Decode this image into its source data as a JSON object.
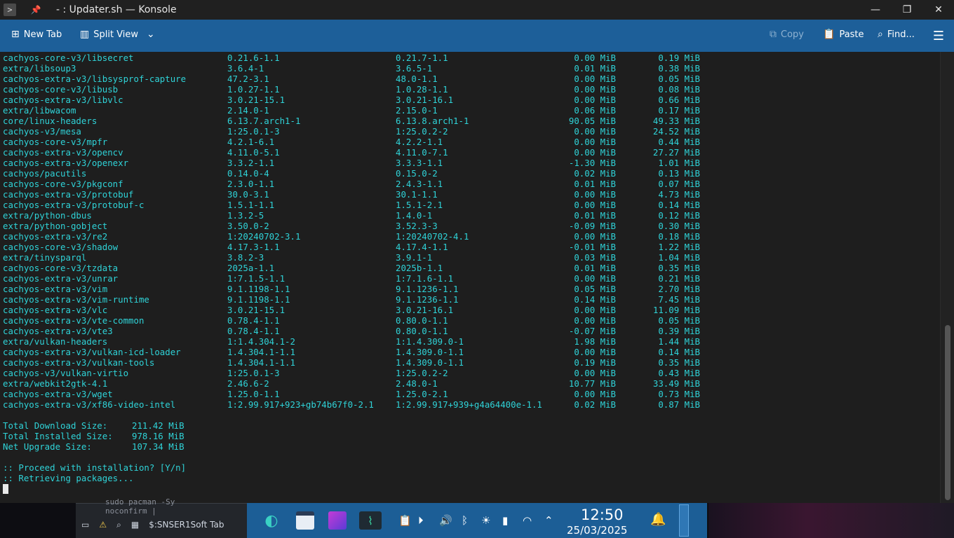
{
  "window": {
    "title": "- : Updater.sh — Konsole",
    "app_icon": "terminal-icon",
    "pin_icon": "pin-icon"
  },
  "toolbar": {
    "new_tab": "New Tab",
    "split_view": "Split View",
    "copy": "Copy",
    "paste": "Paste",
    "find": "Find..."
  },
  "packages": [
    [
      "cachyos-core-v3/libsecret",
      "0.21.6-1.1",
      "0.21.7-1.1",
      "0.00 MiB",
      "0.19 MiB"
    ],
    [
      "extra/libsoup3",
      "3.6.4-1",
      "3.6.5-1",
      "0.01 MiB",
      "0.38 MiB"
    ],
    [
      "cachyos-extra-v3/libsysprof-capture",
      "47.2-3.1",
      "48.0-1.1",
      "0.00 MiB",
      "0.05 MiB"
    ],
    [
      "cachyos-core-v3/libusb",
      "1.0.27-1.1",
      "1.0.28-1.1",
      "0.00 MiB",
      "0.08 MiB"
    ],
    [
      "cachyos-extra-v3/libvlc",
      "3.0.21-15.1",
      "3.0.21-16.1",
      "0.00 MiB",
      "0.66 MiB"
    ],
    [
      "extra/libwacom",
      "2.14.0-1",
      "2.15.0-1",
      "0.06 MiB",
      "0.17 MiB"
    ],
    [
      "core/linux-headers",
      "6.13.7.arch1-1",
      "6.13.8.arch1-1",
      "90.05 MiB",
      "49.33 MiB"
    ],
    [
      "cachyos-v3/mesa",
      "1:25.0.1-3",
      "1:25.0.2-2",
      "0.00 MiB",
      "24.52 MiB"
    ],
    [
      "cachyos-core-v3/mpfr",
      "4.2.1-6.1",
      "4.2.2-1.1",
      "0.00 MiB",
      "0.44 MiB"
    ],
    [
      "cachyos-extra-v3/opencv",
      "4.11.0-5.1",
      "4.11.0-7.1",
      "0.00 MiB",
      "27.27 MiB"
    ],
    [
      "cachyos-extra-v3/openexr",
      "3.3.2-1.1",
      "3.3.3-1.1",
      "-1.30 MiB",
      "1.01 MiB"
    ],
    [
      "cachyos/pacutils",
      "0.14.0-4",
      "0.15.0-2",
      "0.02 MiB",
      "0.13 MiB"
    ],
    [
      "cachyos-core-v3/pkgconf",
      "2.3.0-1.1",
      "2.4.3-1.1",
      "0.01 MiB",
      "0.07 MiB"
    ],
    [
      "cachyos-extra-v3/protobuf",
      "30.0-3.1",
      "30.1-1.1",
      "0.00 MiB",
      "4.73 MiB"
    ],
    [
      "cachyos-extra-v3/protobuf-c",
      "1.5.1-1.1",
      "1.5.1-2.1",
      "0.00 MiB",
      "0.14 MiB"
    ],
    [
      "extra/python-dbus",
      "1.3.2-5",
      "1.4.0-1",
      "0.01 MiB",
      "0.12 MiB"
    ],
    [
      "extra/python-gobject",
      "3.50.0-2",
      "3.52.3-3",
      "-0.09 MiB",
      "0.30 MiB"
    ],
    [
      "cachyos-extra-v3/re2",
      "1:20240702-3.1",
      "1:20240702-4.1",
      "0.00 MiB",
      "0.18 MiB"
    ],
    [
      "cachyos-core-v3/shadow",
      "4.17.3-1.1",
      "4.17.4-1.1",
      "-0.01 MiB",
      "1.22 MiB"
    ],
    [
      "extra/tinysparql",
      "3.8.2-3",
      "3.9.1-1",
      "0.03 MiB",
      "1.04 MiB"
    ],
    [
      "cachyos-core-v3/tzdata",
      "2025a-1.1",
      "2025b-1.1",
      "0.01 MiB",
      "0.35 MiB"
    ],
    [
      "cachyos-extra-v3/unrar",
      "1:7.1.5-1.1",
      "1:7.1.6-1.1",
      "0.00 MiB",
      "0.21 MiB"
    ],
    [
      "cachyos-extra-v3/vim",
      "9.1.1198-1.1",
      "9.1.1236-1.1",
      "0.05 MiB",
      "2.70 MiB"
    ],
    [
      "cachyos-extra-v3/vim-runtime",
      "9.1.1198-1.1",
      "9.1.1236-1.1",
      "0.14 MiB",
      "7.45 MiB"
    ],
    [
      "cachyos-extra-v3/vlc",
      "3.0.21-15.1",
      "3.0.21-16.1",
      "0.00 MiB",
      "11.09 MiB"
    ],
    [
      "cachyos-extra-v3/vte-common",
      "0.78.4-1.1",
      "0.80.0-1.1",
      "0.00 MiB",
      "0.05 MiB"
    ],
    [
      "cachyos-extra-v3/vte3",
      "0.78.4-1.1",
      "0.80.0-1.1",
      "-0.07 MiB",
      "0.39 MiB"
    ],
    [
      "extra/vulkan-headers",
      "1:1.4.304.1-2",
      "1:1.4.309.0-1",
      "1.98 MiB",
      "1.44 MiB"
    ],
    [
      "cachyos-extra-v3/vulkan-icd-loader",
      "1.4.304.1-1.1",
      "1.4.309.0-1.1",
      "0.00 MiB",
      "0.14 MiB"
    ],
    [
      "cachyos-extra-v3/vulkan-tools",
      "1.4.304.1-1.1",
      "1.4.309.0-1.1",
      "0.19 MiB",
      "0.35 MiB"
    ],
    [
      "cachyos-v3/vulkan-virtio",
      "1:25.0.1-3",
      "1:25.0.2-2",
      "0.00 MiB",
      "0.43 MiB"
    ],
    [
      "extra/webkit2gtk-4.1",
      "2.46.6-2",
      "2.48.0-1",
      "10.77 MiB",
      "33.49 MiB"
    ],
    [
      "cachyos-extra-v3/wget",
      "1.25.0-1.1",
      "1.25.0-2.1",
      "0.00 MiB",
      "0.73 MiB"
    ],
    [
      "cachyos-extra-v3/xf86-video-intel",
      "1:2.99.917+923+gb74b67f0-2.1",
      "1:2.99.917+939+g4a64400e-1.1",
      "0.02 MiB",
      "0.87 MiB"
    ]
  ],
  "summary": [
    [
      "Total Download Size:",
      "211.42 MiB"
    ],
    [
      "Total Installed Size:",
      "978.16 MiB"
    ],
    [
      "Net Upgrade Size:",
      "107.34 MiB"
    ]
  ],
  "prompt": ":: Proceed with installation? [Y/n]",
  "status": ":: Retrieving packages...",
  "background": {
    "code_line1": "sudo pacman -Sy",
    "code_line2": "noconfirm |",
    "task_label": "$:SNSER1Soft Tab"
  },
  "clock": {
    "time": "12:50",
    "date": "25/03/2025"
  }
}
